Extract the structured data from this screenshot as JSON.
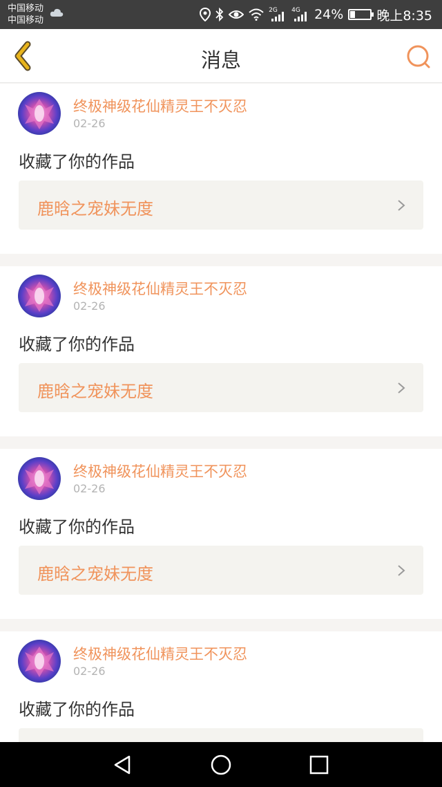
{
  "status_bar": {
    "carrier_1": "中国移动",
    "carrier_2": "中国移动",
    "network_1": "2G",
    "network_2": "4G",
    "battery_percent": "24%",
    "battery_level": 0.24,
    "time": "晚上8:35"
  },
  "nav": {
    "title": "消息",
    "back_icon": "chevron-left-icon",
    "search_icon": "search-icon"
  },
  "messages": [
    {
      "user": "终极神级花仙精灵王不灭忍",
      "date": "02-26",
      "action": "收藏了你的作品",
      "work": "鹿晗之宠妹无度"
    },
    {
      "user": "终极神级花仙精灵王不灭忍",
      "date": "02-26",
      "action": "收藏了你的作品",
      "work": "鹿晗之宠妹无度"
    },
    {
      "user": "终极神级花仙精灵王不灭忍",
      "date": "02-26",
      "action": "收藏了你的作品",
      "work": "鹿晗之宠妹无度"
    },
    {
      "user": "终极神级花仙精灵王不灭忍",
      "date": "02-26",
      "action": "收藏了你的作品",
      "work": ""
    }
  ],
  "colors": {
    "accent": "#f0935b",
    "back_icon": "#e8b41c",
    "work_bg": "#f4f3ef"
  }
}
